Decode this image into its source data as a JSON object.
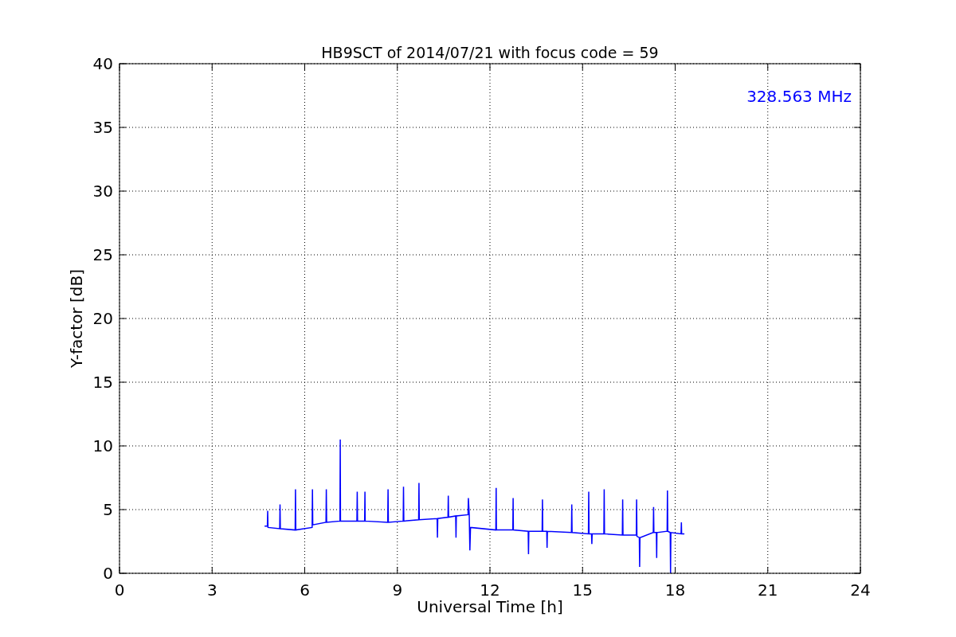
{
  "chart_data": {
    "type": "line",
    "title": "HB9SCT of 2014/07/21 with focus code = 59",
    "xlabel": "Universal Time [h]",
    "ylabel": "Y-factor [dB]",
    "x": [
      4.7,
      4.79,
      4.8,
      4.81,
      5.19,
      5.2,
      5.21,
      5.69,
      5.7,
      5.71,
      6.24,
      6.25,
      6.26,
      6.69,
      6.7,
      6.71,
      7.14,
      7.15,
      7.16,
      7.69,
      7.7,
      7.71,
      7.94,
      7.95,
      7.96,
      8.69,
      8.7,
      8.71,
      9.19,
      9.2,
      9.21,
      9.69,
      9.7,
      9.71,
      10.29,
      10.3,
      10.31,
      10.64,
      10.65,
      10.66,
      10.89,
      10.9,
      10.91,
      11.29,
      11.3,
      11.33,
      11.35,
      11.37,
      12.19,
      12.2,
      12.21,
      12.74,
      12.75,
      12.76,
      13.24,
      13.25,
      13.26,
      13.69,
      13.7,
      13.71,
      13.84,
      13.85,
      13.86,
      14.64,
      14.65,
      14.66,
      15.19,
      15.2,
      15.21,
      15.29,
      15.3,
      15.31,
      15.69,
      15.7,
      15.71,
      16.29,
      16.3,
      16.31,
      16.74,
      16.75,
      16.76,
      16.84,
      16.85,
      16.86,
      17.29,
      17.3,
      17.31,
      17.39,
      17.4,
      17.41,
      17.74,
      17.75,
      17.76,
      17.84,
      17.85,
      17.86,
      18.19,
      18.2,
      18.21,
      18.3
    ],
    "series": [
      {
        "name": "328.563 MHz",
        "color": "#0000ff",
        "values": [
          3.7,
          3.7,
          4.9,
          3.6,
          3.5,
          5.4,
          3.5,
          3.4,
          6.6,
          3.4,
          3.6,
          6.6,
          3.8,
          4.0,
          6.6,
          4.0,
          4.1,
          10.5,
          4.1,
          4.1,
          6.4,
          4.1,
          4.1,
          6.4,
          4.1,
          4.0,
          6.6,
          4.0,
          4.1,
          6.8,
          4.1,
          4.2,
          7.1,
          4.2,
          4.3,
          2.8,
          4.3,
          4.4,
          6.1,
          4.4,
          4.5,
          2.8,
          4.5,
          4.6,
          5.9,
          4.6,
          1.8,
          3.6,
          3.4,
          6.7,
          3.4,
          3.4,
          5.9,
          3.4,
          3.3,
          1.5,
          3.3,
          3.3,
          5.8,
          3.3,
          3.3,
          2.0,
          3.3,
          3.2,
          5.4,
          3.2,
          3.1,
          6.4,
          3.1,
          3.1,
          2.3,
          3.1,
          3.1,
          6.6,
          3.1,
          3.0,
          5.8,
          3.0,
          3.0,
          5.8,
          2.9,
          2.8,
          0.5,
          2.8,
          3.2,
          5.2,
          3.2,
          3.2,
          1.2,
          3.2,
          3.3,
          6.5,
          3.3,
          3.2,
          0.0,
          3.2,
          3.1,
          4.0,
          3.1,
          3.1
        ]
      }
    ],
    "xlim": [
      0,
      24
    ],
    "ylim": [
      0,
      40
    ],
    "xticks": [
      0,
      3,
      6,
      9,
      12,
      15,
      18,
      21,
      24
    ],
    "yticks": [
      0,
      5,
      10,
      15,
      20,
      25,
      30,
      35,
      40
    ],
    "grid": true
  }
}
